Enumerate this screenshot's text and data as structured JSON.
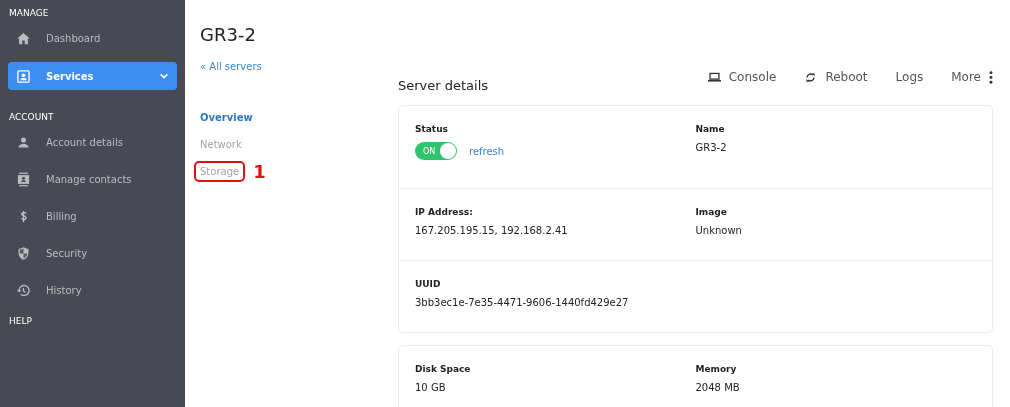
{
  "sidebar": {
    "sections": [
      {
        "title": "MANAGE",
        "items": [
          {
            "label": "Dashboard",
            "selected": false
          },
          {
            "label": "Services",
            "selected": true,
            "expanded": true
          }
        ]
      },
      {
        "title": "ACCOUNT",
        "items": [
          {
            "label": "Account details",
            "selected": false
          },
          {
            "label": "Manage contacts",
            "selected": false
          },
          {
            "label": "Billing",
            "selected": false
          },
          {
            "label": "Security",
            "selected": false
          },
          {
            "label": "History",
            "selected": false
          }
        ]
      },
      {
        "title": "HELP"
      }
    ]
  },
  "page": {
    "title": "GR3-2",
    "back_link": "« All servers"
  },
  "subnav": [
    {
      "label": "Overview",
      "selected": true
    },
    {
      "label": "Network",
      "selected": false
    },
    {
      "label": "Storage",
      "selected": false,
      "annotation": "1"
    }
  ],
  "section_title": "Server details",
  "actions": [
    {
      "label": "Console",
      "kind": "laptop"
    },
    {
      "label": "Reboot",
      "kind": "refresh"
    },
    {
      "label": "Logs",
      "kind": "plain"
    },
    {
      "label": "More",
      "kind": "more"
    }
  ],
  "cards": [
    {
      "rows": [
        {
          "fields": [
            {
              "label": "Status",
              "kind": "status",
              "toggle_label": "ON",
              "on": true,
              "link": "refresh"
            },
            {
              "label": "Name",
              "kind": "text",
              "value": "GR3-2"
            }
          ]
        },
        {
          "fields": [
            {
              "label": "IP Address:",
              "kind": "text",
              "value": "167.205.195.15, 192.168.2.41"
            },
            {
              "label": "Image",
              "kind": "text",
              "value": "Unknown"
            }
          ]
        },
        {
          "fields": [
            {
              "label": "UUID",
              "kind": "text",
              "value": "3bb3ec1e-7e35-4471-9606-1440fd429e27"
            }
          ]
        }
      ]
    },
    {
      "rows": [
        {
          "fields": [
            {
              "label": "Disk Space",
              "kind": "text",
              "value": "10 GB"
            },
            {
              "label": "Memory",
              "kind": "text",
              "value": "2048 MB"
            }
          ]
        }
      ]
    }
  ]
}
